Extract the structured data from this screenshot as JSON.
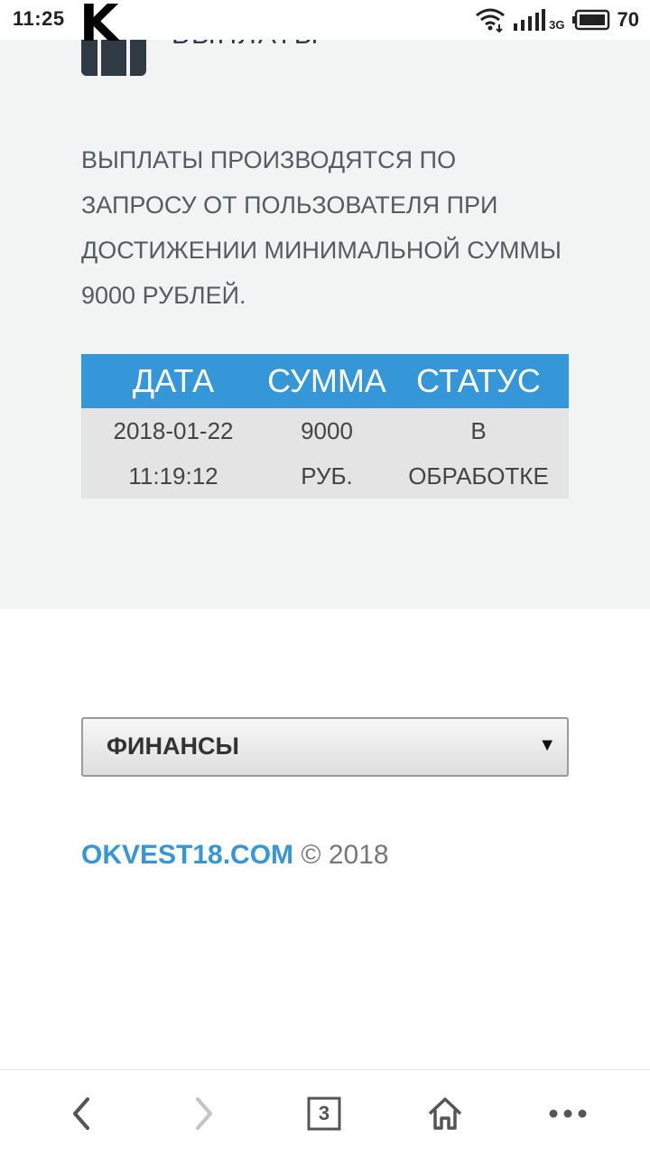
{
  "status_bar": {
    "time": "11:25",
    "app_letter": "K",
    "network_type": "3G",
    "battery": "70"
  },
  "page": {
    "heading": "ВЫПЛАТЫ"
  },
  "info": {
    "text": "ВЫПЛАТЫ ПРОИЗВОДЯТСЯ ПО ЗАПРОСУ ОТ ПОЛЬЗОВАТЕЛЯ ПРИ ДОСТИЖЕНИИ МИНИМАЛЬНОЙ СУММЫ 9000 РУБЛЕЙ."
  },
  "table": {
    "headers": [
      "ДАТА",
      "СУММА",
      "СТАТУС"
    ],
    "rows": [
      {
        "date_line1": "2018-01-22",
        "date_line2": "11:19:12",
        "sum_line1": "9000",
        "sum_line2": "РУБ.",
        "status_line1": "В",
        "status_line2": "ОБРАБОТКЕ"
      }
    ]
  },
  "menu_select": {
    "selected": "ФИНАНСЫ",
    "arrow": "▼"
  },
  "footer": {
    "site": "OKVEST18.COM",
    "copyright": "© 2018"
  },
  "browser_nav": {
    "tab_count": "3"
  },
  "colors": {
    "accent": "#3597d8",
    "content_bg": "#f2f3f3",
    "row_bg": "#e4e4e4"
  },
  "icons": [
    "wifi-icon",
    "signal-icon",
    "battery-icon",
    "back-icon",
    "forward-icon",
    "tabs-icon",
    "home-icon",
    "more-icon"
  ]
}
